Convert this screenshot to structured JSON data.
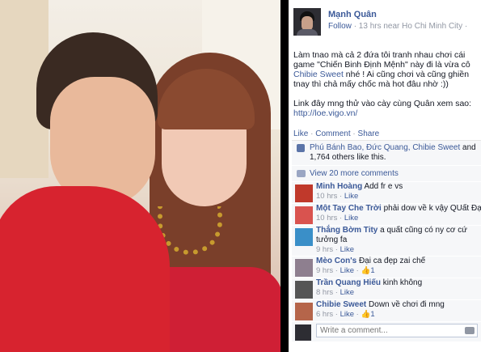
{
  "post": {
    "author": "Mạnh Quân",
    "follow": "Follow",
    "meta": "· 13 hrs near Ho Chi Minh City ·",
    "text_1": "Làm tnao mà cả 2 đứa tôi tranh nhau chơi cái game \"Chiến Binh Định Mệnh\" này đi là vừa cô",
    "text_1_link": "Chibie Sweet",
    "text_1_end": "nhé ! Ai cũng chơi và cũng ghiền tnay thì chả mấy chốc mà hot đâu nhờ :))",
    "text_2": "Link đây mng thử vào cày cùng Quân xem sao:",
    "text_2_link": "http://loe.vigo.vn/"
  },
  "actions": {
    "like": "Like",
    "comment": "Comment",
    "share": "Share"
  },
  "likes": {
    "names": "Phú Bánh Bao, Đức Quang, Chibie Sweet",
    "tail": "and 1,764 others like this."
  },
  "view_more": "View 20 more comments",
  "comments": [
    {
      "name": "Minh Hoàng",
      "text": "Add fr e vs",
      "time": "10 hrs",
      "like": "Like",
      "likes": ""
    },
    {
      "name": "Một Tay Che Trời",
      "text": "phải dow về k vậy QUất Đại K",
      "time": "10 hrs",
      "like": "Like",
      "likes": ""
    },
    {
      "name": "Thắng Bờm Tity",
      "text": "a quất cũng có ny cơ cứ tưởng fa",
      "time": "9 hrs",
      "like": "Like",
      "likes": ""
    },
    {
      "name": "Mèo Con's",
      "text": "Đại ca đẹp zai chế",
      "time": "9 hrs",
      "like": "Like",
      "likes": "1"
    },
    {
      "name": "Trần Quang Hiếu",
      "text": "kinh không",
      "time": "8 hrs",
      "like": "Like",
      "likes": ""
    },
    {
      "name": "Chibie Sweet",
      "text": "Down về chơi đi mng",
      "time": "6 hrs",
      "like": "Like",
      "likes": "1"
    }
  ],
  "write_placeholder": "Write a comment...",
  "colors": {
    "link": "#3b5998",
    "meta": "#9197a3",
    "panel": "#f6f7f9"
  }
}
